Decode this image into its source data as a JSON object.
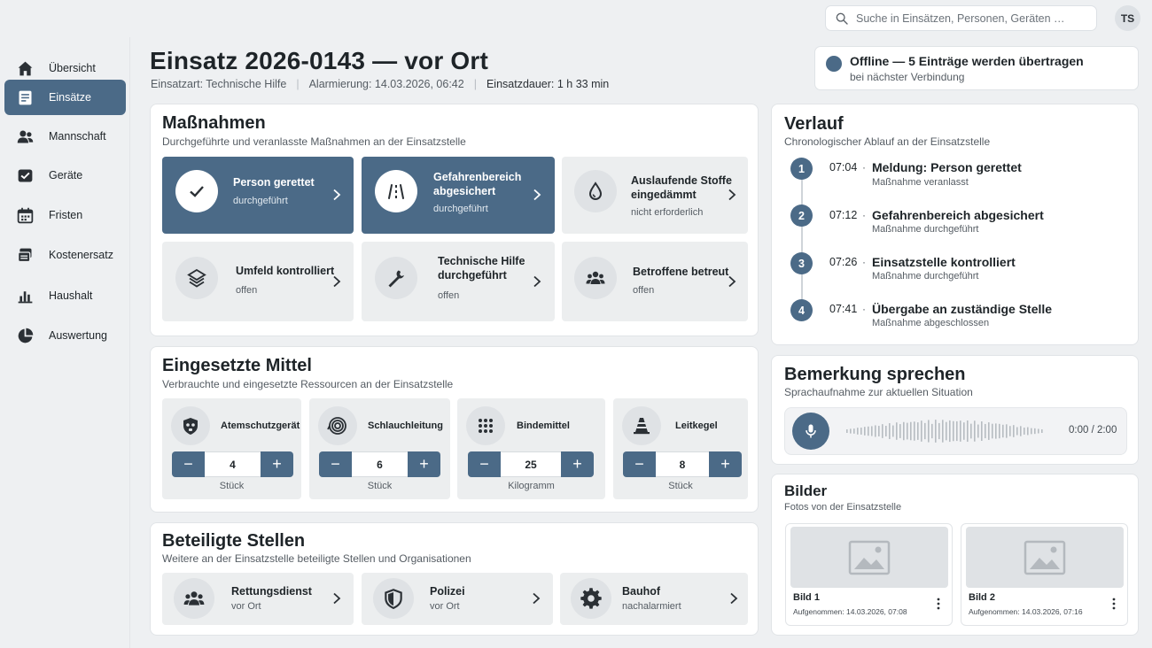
{
  "search": {
    "placeholder": "Suche in Einsätzen, Personen, Geräten …"
  },
  "user": {
    "initials": "TS"
  },
  "colors": {
    "accent": "#4b6a87",
    "tile_bg": "#eceeef",
    "page_bg": "#eef0f2"
  },
  "sidebar": {
    "items": [
      {
        "label": "Übersicht",
        "icon": "home-icon",
        "active": false
      },
      {
        "label": "Einsätze",
        "icon": "document-icon",
        "active": true
      },
      {
        "label": "Mannschaft",
        "icon": "person-icon",
        "active": false
      },
      {
        "label": "Geräte",
        "icon": "device-icon",
        "active": false
      },
      {
        "label": "Fristen",
        "icon": "calendar-icon",
        "active": false
      },
      {
        "label": "Kostenersatz",
        "icon": "money-icon",
        "active": false
      },
      {
        "label": "Haushalt",
        "icon": "bar-chart-icon",
        "active": false
      },
      {
        "label": "Auswertung",
        "icon": "pie-chart-icon",
        "active": false
      }
    ]
  },
  "header": {
    "title": "Einsatz 2026-0143 — vor Ort",
    "type": "Einsatzart: Technische Hilfe",
    "alarm": "Alarmierung: 14.03.2026, 06:42",
    "duration": "Einsatzdauer: 1 h 33 min"
  },
  "offline": {
    "title": "Offline — 5 Einträge werden übertragen",
    "subtitle": "bei nächster Verbindung"
  },
  "measures": {
    "title": "Maßnahmen",
    "subtitle": "Durchgeführte und veranlasste Maßnahmen an der Einsatzstelle",
    "items": [
      {
        "label": "Person gerettet",
        "status": "durchgeführt",
        "done": true,
        "icon": "check-icon"
      },
      {
        "label": "Gefahrenbereich abgesichert",
        "status": "durchgeführt",
        "done": true,
        "icon": "barrier-icon"
      },
      {
        "label": "Auslaufende Stoffe eingedämmt",
        "status": "nicht erforderlich",
        "done": false,
        "icon": "drop-icon"
      },
      {
        "label": "Umfeld kontrolliert",
        "status": "offen",
        "done": false,
        "icon": "layers-icon"
      },
      {
        "label": "Technische Hilfe durchgeführt",
        "status": "offen",
        "done": false,
        "icon": "wrench-icon"
      },
      {
        "label": "Betroffene betreut",
        "status": "offen",
        "done": false,
        "icon": "group-icon"
      }
    ]
  },
  "resources": {
    "title": "Eingesetzte Mittel",
    "subtitle": "Verbrauchte und eingesetzte Ressourcen an der Einsatzstelle",
    "items": [
      {
        "name": "Atemschutzgerät",
        "value": "4",
        "unit": "Stück",
        "icon": "mask-icon"
      },
      {
        "name": "Schlauchleitung",
        "value": "6",
        "unit": "Stück",
        "icon": "hose-icon"
      },
      {
        "name": "Bindemittel",
        "value": "25",
        "unit": "Kilogramm",
        "icon": "dots-icon"
      },
      {
        "name": "Leitkegel",
        "value": "8",
        "unit": "Stück",
        "icon": "cone-icon"
      }
    ]
  },
  "units": {
    "title": "Beteiligte Stellen",
    "subtitle": "Weitere an der Einsatzstelle beteiligte Stellen und Organisationen",
    "items": [
      {
        "name": "Rettungsdienst",
        "status": "vor Ort",
        "icon": "group-icon"
      },
      {
        "name": "Polizei",
        "status": "vor Ort",
        "icon": "shield-icon"
      },
      {
        "name": "Bauhof",
        "status": "nachalarmiert",
        "icon": "gear-icon"
      }
    ]
  },
  "timeline": {
    "title": "Verlauf",
    "subtitle": "Chronologischer Ablauf an der Einsatzstelle",
    "items": [
      {
        "n": "1",
        "time": "07:04",
        "title": "Meldung: Person gerettet",
        "sub": "Maßnahme veranlasst"
      },
      {
        "n": "2",
        "time": "07:12",
        "title": "Gefahrenbereich abgesichert",
        "sub": "Maßnahme durchgeführt"
      },
      {
        "n": "3",
        "time": "07:26",
        "title": "Einsatzstelle kontrolliert",
        "sub": "Maßnahme durchgeführt"
      },
      {
        "n": "4",
        "time": "07:41",
        "title": "Übergabe an zuständige Stelle",
        "sub": "Maßnahme abgeschlossen"
      }
    ]
  },
  "voice": {
    "title": "Bemerkung sprechen",
    "subtitle": "Sprachaufnahme zur aktuellen Situation",
    "time": "0:00 / 2:00"
  },
  "images": {
    "title": "Bilder",
    "subtitle": "Fotos von der Einsatzstelle",
    "items": [
      {
        "name": "Bild 1",
        "date": "Aufgenommen: 14.03.2026, 07:08"
      },
      {
        "name": "Bild 2",
        "date": "Aufgenommen: 14.03.2026, 07:16"
      }
    ]
  }
}
